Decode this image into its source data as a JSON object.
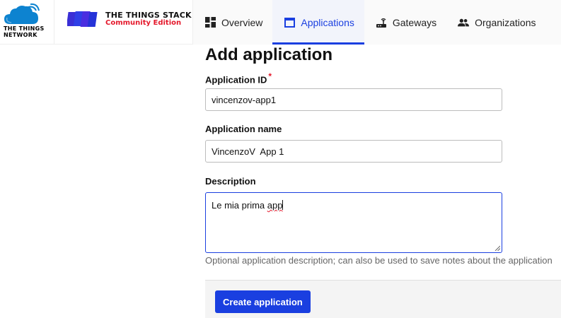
{
  "brand": {
    "ttn_line1": "THE THINGS",
    "ttn_line2": "NETWORK",
    "stack_title": "THE THINGS STACK",
    "stack_edition": "Community Edition",
    "accent": "#1a3fe0",
    "red": "#e4182b"
  },
  "nav": {
    "items": [
      {
        "label": "Overview",
        "icon": "dashboard-icon"
      },
      {
        "label": "Applications",
        "icon": "application-icon",
        "active": true
      },
      {
        "label": "Gateways",
        "icon": "router-icon"
      },
      {
        "label": "Organizations",
        "icon": "people-icon"
      }
    ]
  },
  "form": {
    "title": "Add application",
    "app_id_label": "Application ID",
    "required_mark": "*",
    "app_id_value": "vincenzov-app1",
    "app_name_label": "Application name",
    "app_name_value": "VincenzoV  App 1",
    "description_label": "Description",
    "description_value_prefix": "Le mia prima ",
    "description_value_misspelled": "app",
    "description_hint": "Optional application description; can also be used to save notes about the application",
    "submit_label": "Create application"
  }
}
